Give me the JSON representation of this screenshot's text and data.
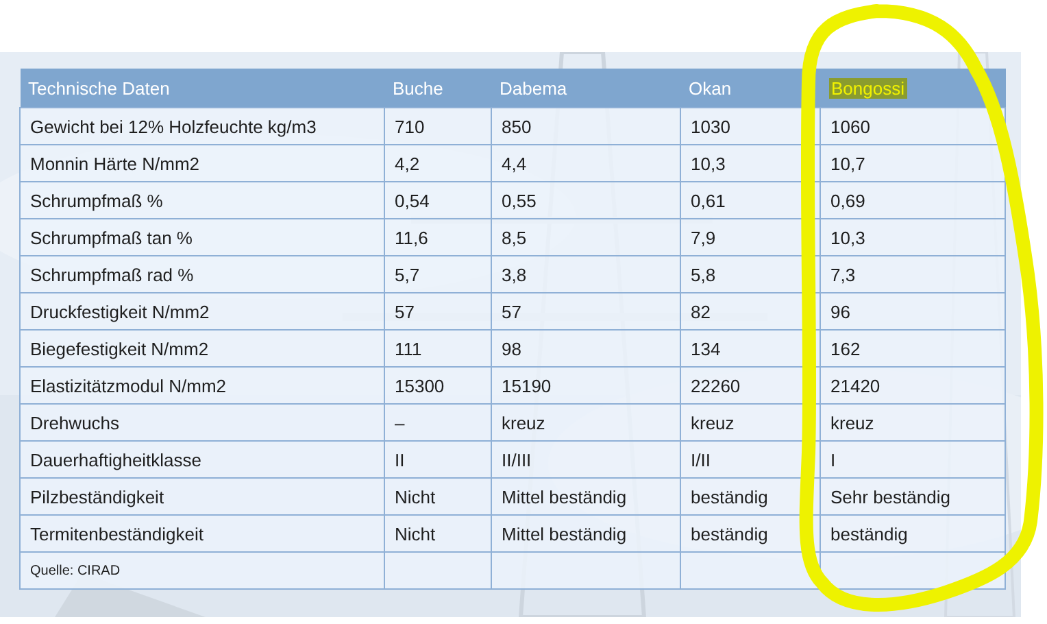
{
  "table": {
    "columns": [
      {
        "label": "Technische Daten",
        "highlighted": false
      },
      {
        "label": "Buche",
        "highlighted": false
      },
      {
        "label": "Dabema",
        "highlighted": false
      },
      {
        "label": "Okan",
        "highlighted": false
      },
      {
        "label": "Bongossi",
        "highlighted": true
      }
    ],
    "rows": [
      [
        "Gewicht bei 12% Holzfeuchte kg/m3",
        "710",
        "850",
        "1030",
        "1060"
      ],
      [
        "Monnin Härte N/mm2",
        "4,2",
        "4,4",
        "10,3",
        "10,7"
      ],
      [
        "Schrumpfmaß %",
        "0,54",
        "0,55",
        "0,61",
        "0,69"
      ],
      [
        "Schrumpfmaß tan %",
        "11,6",
        "8,5",
        "7,9",
        "10,3"
      ],
      [
        "Schrumpfmaß rad %",
        "5,7",
        "3,8",
        "5,8",
        "7,3"
      ],
      [
        "Druckfestigkeit N/mm2",
        "57",
        "57",
        "82",
        "96"
      ],
      [
        "Biegefestigkeit N/mm2",
        "111",
        "98",
        "134",
        "162"
      ],
      [
        "Elastizitätzmodul N/mm2",
        "15300",
        "15190",
        "22260",
        "21420"
      ],
      [
        "Drehwuchs",
        "–",
        "kreuz",
        "kreuz",
        "kreuz"
      ],
      [
        "Dauerhaftigheitklasse",
        "II",
        "II/III",
        "I/II",
        "I"
      ],
      [
        "Pilzbeständigkeit",
        "Nicht",
        "Mittel beständig",
        "beständig",
        "Sehr beständig"
      ],
      [
        "Termitenbeständigkeit",
        "Nicht",
        "Mittel beständig",
        "beständig",
        "beständig"
      ]
    ],
    "source": "Quelle: CIRAD"
  },
  "annotation": {
    "kind": "loop"
  }
}
